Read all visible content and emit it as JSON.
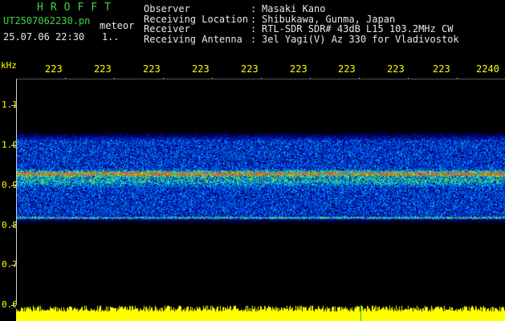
{
  "header": {
    "title": "HROFFT",
    "filename": "UT2507062230.pn",
    "suffix": "meteor",
    "datetime": "25.07.06 22:30   1..",
    "fields": [
      {
        "label": "Observer",
        "value": "Masaki Kano"
      },
      {
        "label": "Receiving Location",
        "value": "Shibukawa, Gunma, Japan"
      },
      {
        "label": "Receiver",
        "value": "RTL-SDR SDR# 43dB L15 103.2MHz CW"
      },
      {
        "label": "Receiving Antenna",
        "value": "3el Yagi(V) Az 330 for Vladivostok"
      }
    ]
  },
  "y_axis": {
    "unit": "kHz",
    "ticks": [
      "1.1",
      "1.0",
      "0.9",
      "0.8",
      "0.7",
      "0.6"
    ]
  },
  "x_axis": {
    "ticks": [
      "223",
      "223",
      "223",
      "223",
      "223",
      "223",
      "223",
      "223",
      "223",
      "2240"
    ]
  },
  "colors": {
    "header_title": "#3fd43f",
    "header_text": "#e8e8e8",
    "axis_text": "#ffff00",
    "meter": "#ffff00"
  }
}
